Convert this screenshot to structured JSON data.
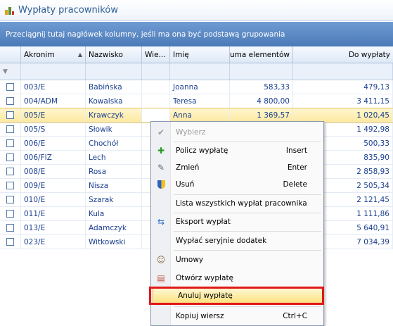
{
  "window": {
    "title": "Wypłaty pracowników"
  },
  "group_hint": "Przeciągnij tutaj nagłówek kolumny, jeśli ma ona być podstawą grupowania",
  "columns": {
    "akronim": "Akronim",
    "nazwisko": "Nazwisko",
    "wie": "Wie...",
    "imie": "Imię",
    "suma": "Suma elementów",
    "do_wyplaty": "Do wypłaty"
  },
  "rows": [
    {
      "akronim": "003/E",
      "nazwisko": "Babińska",
      "imie": "Joanna",
      "suma": "583,33",
      "do_wyplaty": "479,13"
    },
    {
      "akronim": "004/ADM",
      "nazwisko": "Kowalska",
      "imie": "Teresa",
      "suma": "4 800,00",
      "do_wyplaty": "3 411,15"
    },
    {
      "akronim": "005/E",
      "nazwisko": "Krawczyk",
      "imie": "Anna",
      "suma": "1 369,57",
      "do_wyplaty": "1 020,45"
    },
    {
      "akronim": "005/S",
      "nazwisko": "Słowik",
      "imie": "",
      "suma": "",
      "do_wyplaty": "1 492,98"
    },
    {
      "akronim": "006/E",
      "nazwisko": "Chochół",
      "imie": "",
      "suma": "",
      "do_wyplaty": "500,33"
    },
    {
      "akronim": "006/FIZ",
      "nazwisko": "Lech",
      "imie": "",
      "suma": "",
      "do_wyplaty": "835,90"
    },
    {
      "akronim": "008/E",
      "nazwisko": "Rosa",
      "imie": "",
      "suma": "",
      "do_wyplaty": "2 858,93"
    },
    {
      "akronim": "009/E",
      "nazwisko": "Nisza",
      "imie": "",
      "suma": "",
      "do_wyplaty": "2 505,34"
    },
    {
      "akronim": "010/E",
      "nazwisko": "Szarak",
      "imie": "",
      "suma": "",
      "do_wyplaty": "2 121,45"
    },
    {
      "akronim": "011/E",
      "nazwisko": "Kula",
      "imie": "",
      "suma": "",
      "do_wyplaty": "1 111,86"
    },
    {
      "akronim": "013/E",
      "nazwisko": "Adamczyk",
      "imie": "",
      "suma": "",
      "do_wyplaty": "5 640,91"
    },
    {
      "akronim": "023/E",
      "nazwisko": "Witkowski",
      "imie": "",
      "suma": "",
      "do_wyplaty": "7 034,39"
    }
  ],
  "menu": {
    "wybierz": "Wybierz",
    "policz": "Policz wypłatę",
    "policz_sc": "Insert",
    "zmien": "Zmień",
    "zmien_sc": "Enter",
    "usun": "Usuń",
    "usun_sc": "Delete",
    "lista": "Lista wszystkich wypłat pracownika",
    "eksport": "Eksport wypłat",
    "seryjnie": "Wypłać seryjnie dodatek",
    "umowy": "Umowy",
    "otworz": "Otwórz wypłatę",
    "anuluj": "Anuluj wypłatę",
    "kopiuj": "Kopiuj wiersz",
    "kopiuj_sc": "Ctrl+C"
  },
  "icons": {
    "app": "chart-icon",
    "funnel": "filter-icon",
    "sort": "sort-ascending-icon",
    "check": "check-icon",
    "plus": "plus-icon",
    "pen": "pen-icon",
    "shield": "shield-icon",
    "export": "export-icon",
    "people": "people-icon",
    "open": "open-icon"
  },
  "colors": {
    "highlight": "#e01818",
    "header": "#4b7ab8",
    "row_text": "#1a3f8f"
  }
}
